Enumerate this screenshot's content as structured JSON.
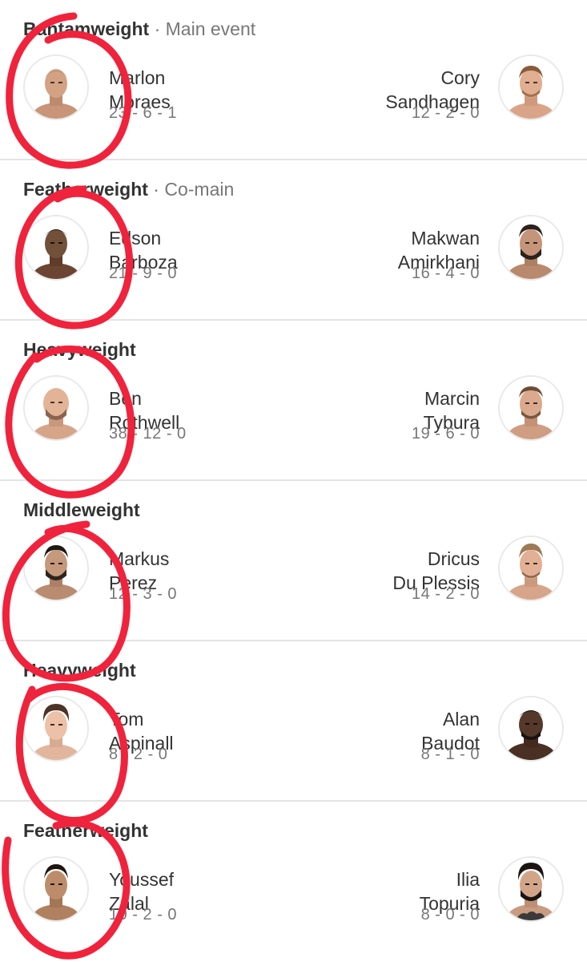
{
  "fights": [
    {
      "weight_class": "Bantamweight",
      "separator": "·",
      "slot": "Main event",
      "red": {
        "first": "Marlon",
        "last": "Moraes",
        "record": "23 - 6 - 1"
      },
      "blue": {
        "first": "Cory",
        "last": "Sandhagen",
        "record": "12 - 2 - 0"
      }
    },
    {
      "weight_class": "Featherweight",
      "separator": "·",
      "slot": "Co-main",
      "red": {
        "first": "Edson",
        "last": "Barboza",
        "record": "21 - 9 - 0"
      },
      "blue": {
        "first": "Makwan",
        "last": "Amirkhani",
        "record": "16 - 4 - 0"
      }
    },
    {
      "weight_class": "Heavyweight",
      "separator": "",
      "slot": "",
      "red": {
        "first": "Ben",
        "last": "Rothwell",
        "record": "38 - 12 - 0"
      },
      "blue": {
        "first": "Marcin",
        "last": "Tybura",
        "record": "19 - 6 - 0"
      }
    },
    {
      "weight_class": "Middleweight",
      "separator": "",
      "slot": "",
      "red": {
        "first": "Markus",
        "last": "Perez",
        "record": "12 - 3 - 0"
      },
      "blue": {
        "first": "Dricus",
        "last": "Du Plessis",
        "record": "14 - 2 - 0"
      }
    },
    {
      "weight_class": "Heavyweight",
      "separator": "",
      "slot": "",
      "red": {
        "first": "Tom",
        "last": "Aspinall",
        "record": "8 - 2 - 0"
      },
      "blue": {
        "first": "Alan",
        "last": "Baudot",
        "record": "8 - 1 - 0"
      }
    },
    {
      "weight_class": "Featherweight",
      "separator": "",
      "slot": "",
      "red": {
        "first": "Youssef",
        "last": "Zalal",
        "record": "10 - 2 - 0"
      },
      "blue": {
        "first": "Ilia",
        "last": "Topuria",
        "record": "8 - 0 - 0"
      }
    }
  ],
  "icons": {
    "fighter_photo": "fighter-headshot",
    "annotation": "red-hand-drawn-circles"
  },
  "colors": {
    "annotation": "#f0233c",
    "divider": "#e4e4e4",
    "muted_text": "#777777"
  }
}
